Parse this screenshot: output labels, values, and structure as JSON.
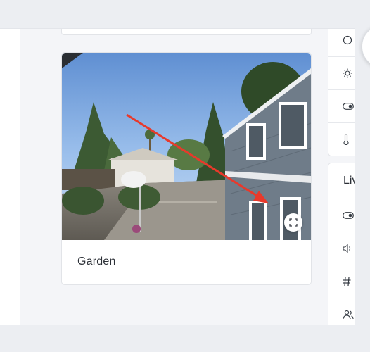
{
  "camera_card": {
    "title": "Garden",
    "expand_icon": "fullscreen-icon"
  },
  "right_panel_top": {
    "icons": [
      "circle-icon",
      "sun-icon",
      "toggle-icon",
      "thermometer-icon"
    ]
  },
  "right_panel_bottom": {
    "header_label": "Liv",
    "icons": [
      "toggle-icon",
      "speaker-icon",
      "hash-icon",
      "people-icon"
    ]
  },
  "colors": {
    "annotation_arrow": "#e8392b",
    "sky": "#8fb6e8",
    "house_siding": "#6f7c89"
  }
}
